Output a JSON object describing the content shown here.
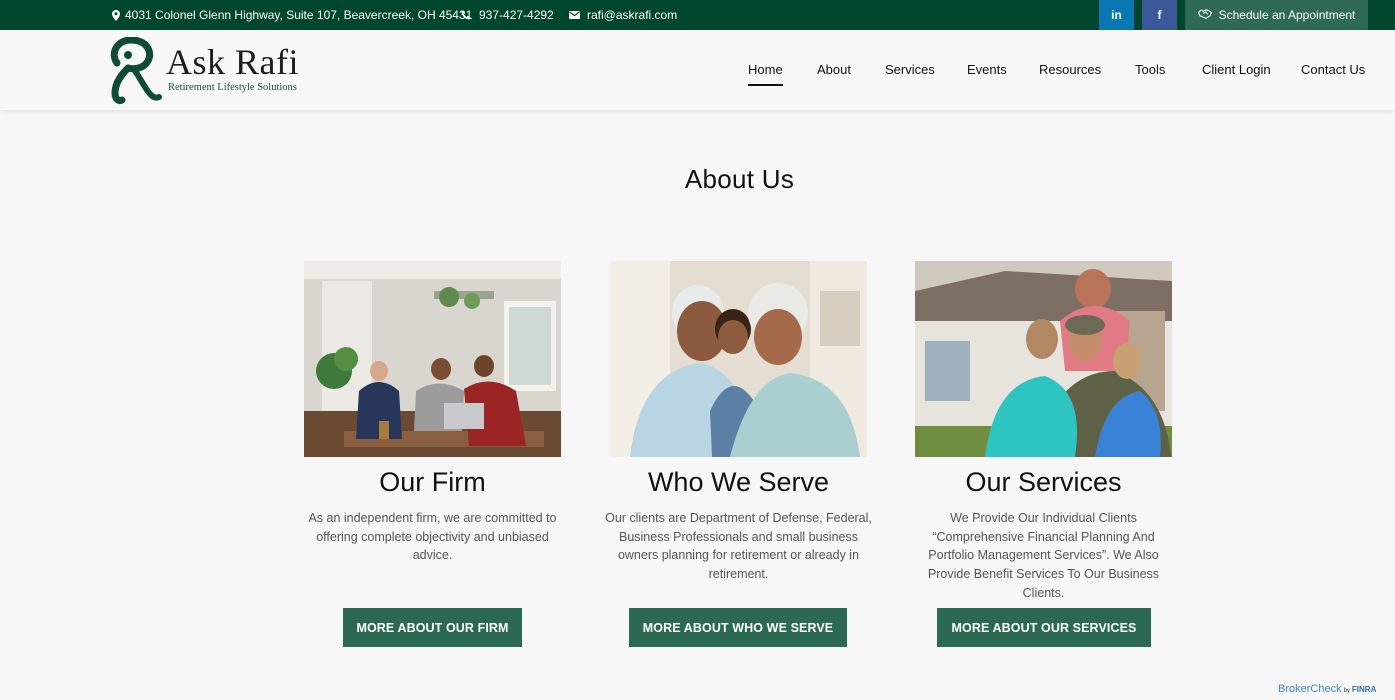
{
  "topbar": {
    "address": "4031 Colonel Glenn Highway, Suite 107, Beavercreek, OH 45431",
    "phone": "937-427-4292",
    "email": "rafi@askrafi.com",
    "linkedin": "in",
    "facebook": "f",
    "appointment": "Schedule an Appointment"
  },
  "brand": {
    "name": "Ask Rafi",
    "tagline": "Retirement Lifestyle Solutions"
  },
  "nav": [
    "Home",
    "About",
    "Services",
    "Events",
    "Resources",
    "Tools",
    "Client Login",
    "Contact Us"
  ],
  "nav_active": "Home",
  "page_title": "About Us",
  "cards": [
    {
      "title": "Our Firm",
      "text": "As an independent firm, we are committed to offering complete objectivity and unbiased advice.",
      "button": "MORE ABOUT OUR FIRM"
    },
    {
      "title": "Who We Serve",
      "text": "Our clients are Department of Defense, Federal, Business Professionals and small business owners planning for retirement or already in retirement.",
      "button": "MORE ABOUT WHO WE SERVE"
    },
    {
      "title": "Our Services",
      "text": "We Provide Our Individual Clients “Comprehensive Financial Planning And Portfolio Management Services”.  We Also Provide Benefit Services To Our Business Clients.",
      "button": "MORE ABOUT OUR SERVICES"
    }
  ],
  "brokercheck": {
    "label": "BrokerCheck",
    "by": "by",
    "finra": "FINRA"
  },
  "colors": {
    "topbar": "#01472e",
    "accent_green": "#2b6a50",
    "linkedin": "#0a77b5",
    "facebook": "#3b5998"
  },
  "icons": [
    "map-marker-icon",
    "phone-icon",
    "envelope-icon",
    "handshake-icon"
  ]
}
